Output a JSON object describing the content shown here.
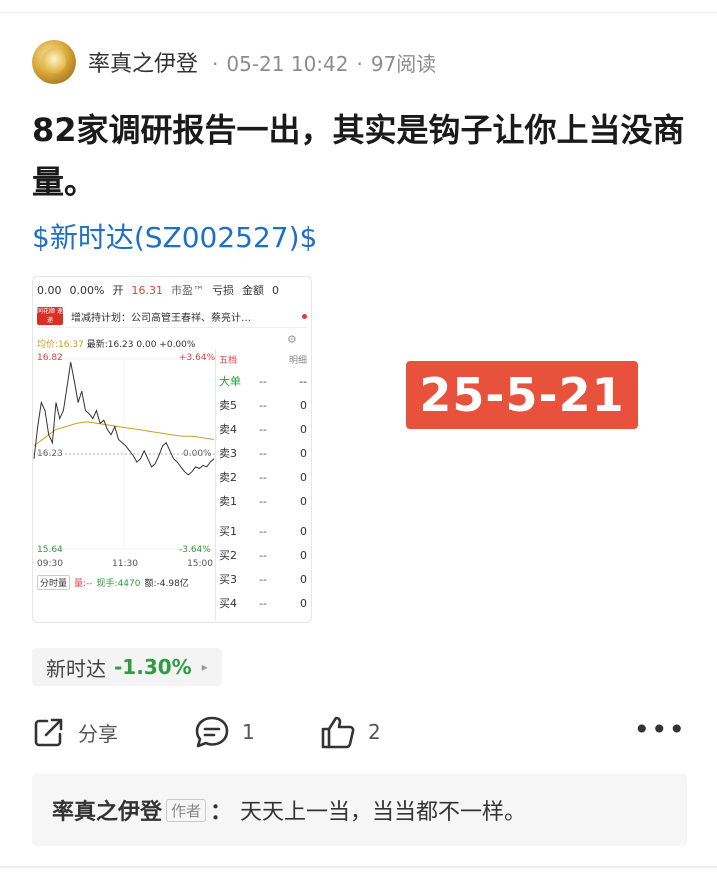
{
  "author": {
    "name": "率真之伊登",
    "date": "05-21 10:42",
    "reads": "97阅读"
  },
  "post": {
    "title": "82家调研报告一出，其实是钩子让你上当没商量。",
    "stock_link": "$新时达(SZ002527)$"
  },
  "chart_image": {
    "top_bar": {
      "price_change": "0.00",
      "pct_change": "0.00%",
      "open_label": "开",
      "open_value": "16.31",
      "pe_label": "市盈™",
      "pe_value": "亏损",
      "amount_label": "金额",
      "amount_value": "0"
    },
    "news_logo": "同花顺 速递",
    "news_text": "增减持计划：公司高管王春祥、蔡亮计…",
    "avg_label": "均价:16.37",
    "latest_label": "最新:16.23",
    "latest_change": "0.00",
    "latest_pct": "+0.00%",
    "high_price": "16.82",
    "high_pct": "+3.64%",
    "mid_price": "16.23",
    "mid_pct": "0.00%",
    "low_price": "15.64",
    "low_pct": "-3.64%",
    "times": [
      "09:30",
      "11:30",
      "15:00"
    ],
    "volume_button": "分时量",
    "volume_label": "量:--",
    "hand_label": "现手:4470",
    "amount_label2": "额:-4.98亿",
    "orderbook_tabs": [
      "五档",
      "明细"
    ],
    "orderbook": [
      {
        "label": "大单",
        "mid": "--",
        "val": "--",
        "big": true
      },
      {
        "label": "卖5",
        "mid": "--",
        "val": "0"
      },
      {
        "label": "卖4",
        "mid": "--",
        "val": "0"
      },
      {
        "label": "卖3",
        "mid": "--",
        "val": "0"
      },
      {
        "label": "卖2",
        "mid": "--",
        "val": "0"
      },
      {
        "label": "卖1",
        "mid": "--",
        "val": "0"
      },
      {
        "label": "买1",
        "mid": "--",
        "val": "0"
      },
      {
        "label": "买2",
        "mid": "--",
        "val": "0"
      },
      {
        "label": "买3",
        "mid": "--",
        "val": "0"
      },
      {
        "label": "买4",
        "mid": "--",
        "val": "0"
      }
    ],
    "price_series": [
      16.2,
      16.4,
      16.55,
      16.5,
      16.35,
      16.3,
      16.55,
      16.45,
      16.5,
      16.65,
      16.8,
      16.68,
      16.55,
      16.62,
      16.5,
      16.48,
      16.45,
      16.5,
      16.42,
      16.44,
      16.38,
      16.35,
      16.4,
      16.32,
      16.3,
      16.28,
      16.25,
      16.22,
      16.18,
      16.2,
      16.25,
      16.2,
      16.15,
      16.17,
      16.22,
      16.28,
      16.3,
      16.25,
      16.2,
      16.18,
      16.15,
      16.12,
      16.1,
      16.12,
      16.15,
      16.14,
      16.16,
      16.15,
      16.18,
      16.2
    ],
    "avg_series": [
      16.28,
      16.33,
      16.38,
      16.4,
      16.42,
      16.43,
      16.42,
      16.41,
      16.4,
      16.39,
      16.38,
      16.37,
      16.36,
      16.35,
      16.34,
      16.34,
      16.33,
      16.32
    ],
    "colors": {
      "up": "#e04040",
      "down": "#2b9b3a",
      "avg": "#c9a21b"
    }
  },
  "date_badge": "25-5-21",
  "stock_pill": {
    "name": "新时达",
    "pct": "-1.30%",
    "arrow": "▸"
  },
  "actions": {
    "share_label": "分享",
    "comment_count": "1",
    "like_count": "2",
    "more": "•••"
  },
  "comment_preview": {
    "author": "率真之伊登",
    "tag": "作者",
    "colon": "：",
    "text": "天天上一当，当当都不一样。"
  },
  "colors": {
    "link": "#1e6fc6",
    "badge": "#e8523c",
    "down": "#2f9b43"
  }
}
